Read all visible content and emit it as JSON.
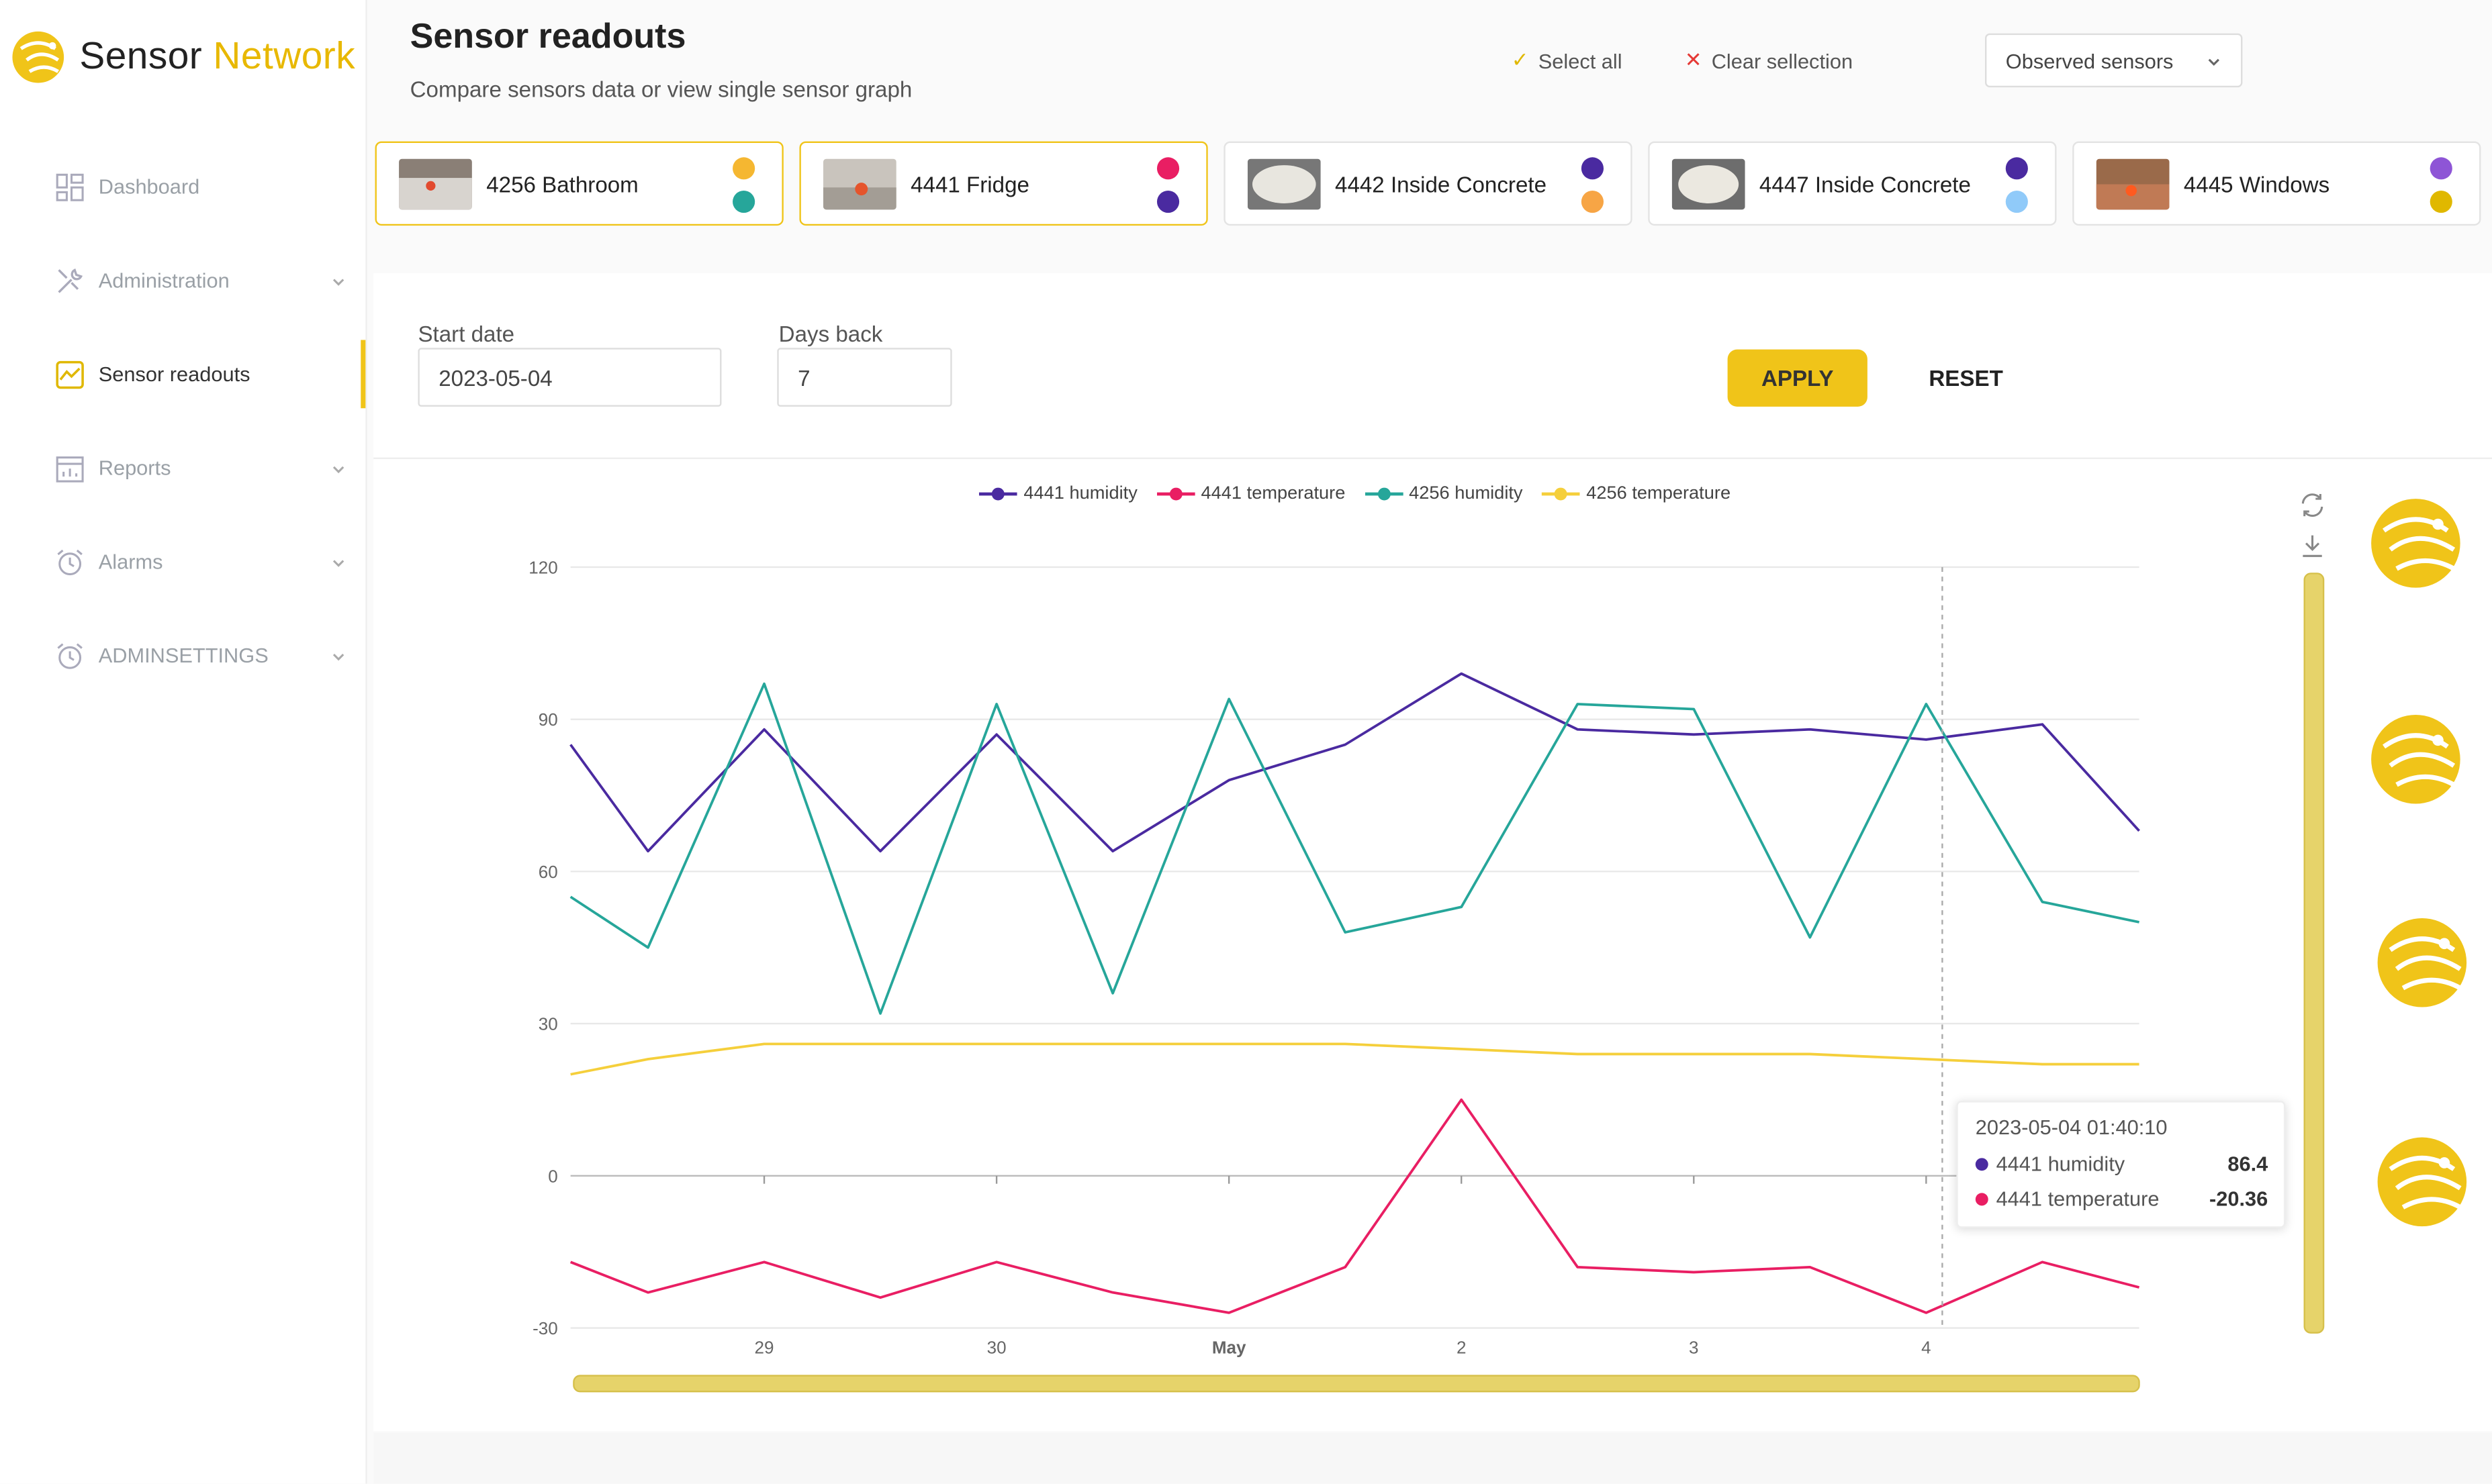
{
  "brand": {
    "name_part1": "Sensor",
    "name_part2": "Network",
    "color": "#f0c419"
  },
  "sidebar": {
    "items": [
      {
        "label": "Dashboard",
        "icon": "dashboard-icon",
        "active": false,
        "expandable": false
      },
      {
        "label": "Administration",
        "icon": "tools-icon",
        "active": false,
        "expandable": true
      },
      {
        "label": "Sensor readouts",
        "icon": "chart-window-icon",
        "active": true,
        "expandable": false
      },
      {
        "label": "Reports",
        "icon": "report-icon",
        "active": false,
        "expandable": true
      },
      {
        "label": "Alarms",
        "icon": "alarm-clock-icon",
        "active": false,
        "expandable": true
      },
      {
        "label": "ADMINSETTINGS",
        "icon": "alarm-clock-icon",
        "active": false,
        "expandable": true
      }
    ]
  },
  "header": {
    "title": "Sensor readouts",
    "subtitle": "Compare sensors data or view single sensor graph",
    "select_all": "Select all",
    "clear_selection": "Clear sellection",
    "dropdown_value": "Observed sensors"
  },
  "sensors": [
    {
      "label": "4256 Bathroom",
      "selected": true,
      "dot1": "#f5b731",
      "dot2": "#26a69a"
    },
    {
      "label": "4441 Fridge",
      "selected": true,
      "dot1": "#e91e63",
      "dot2": "#4a2aa0"
    },
    {
      "label": "4442 Inside Concrete",
      "selected": false,
      "dot1": "#4a2aa0",
      "dot2": "#f7a545"
    },
    {
      "label": "4447 Inside Concrete",
      "selected": false,
      "dot1": "#4a2aa0",
      "dot2": "#90caf9"
    },
    {
      "label": "4445 Windows",
      "selected": false,
      "dot1": "#8e55d6",
      "dot2": "#e0b800"
    }
  ],
  "filters": {
    "start_date_label": "Start date",
    "start_date_value": "2023-05-04",
    "days_back_label": "Days back",
    "days_back_value": "7",
    "apply_label": "APPLY",
    "reset_label": "RESET"
  },
  "tooltip": {
    "title": "2023-05-04 01:40:10",
    "rows": [
      {
        "label": "4441 humidity",
        "value": "86.4",
        "color": "#4a2aa0"
      },
      {
        "label": "4441 temperature",
        "value": "-20.36",
        "color": "#e91e63"
      }
    ]
  },
  "chart_data": {
    "type": "line",
    "title": "",
    "xlabel": "",
    "ylabel": "",
    "ylim": [
      -30,
      120
    ],
    "yticks": [
      120,
      90,
      60,
      30,
      0,
      -30
    ],
    "x_tick_labels": [
      "29",
      "30",
      "May",
      "2",
      "3",
      "4"
    ],
    "x": [
      "2023-04-28 04:00",
      "2023-04-28 12:00",
      "2023-04-29 00:00",
      "2023-04-29 12:00",
      "2023-04-30 00:00",
      "2023-04-30 12:00",
      "2023-05-01 00:00",
      "2023-05-01 12:00",
      "2023-05-02 00:00",
      "2023-05-02 12:00",
      "2023-05-03 00:00",
      "2023-05-03 12:00",
      "2023-05-04 00:00",
      "2023-05-04 12:00",
      "2023-05-04 22:00"
    ],
    "legend_position": "top",
    "grid": true,
    "series": [
      {
        "name": "4441 humidity",
        "color": "#4a2aa0",
        "values": [
          85,
          64,
          88,
          64,
          87,
          64,
          78,
          85,
          99,
          88,
          87,
          88,
          86,
          89,
          68
        ]
      },
      {
        "name": "4441 temperature",
        "color": "#e91e63",
        "values": [
          -17,
          -23,
          -17,
          -24,
          -17,
          -23,
          -27,
          -18,
          15,
          -18,
          -19,
          -18,
          -27,
          -17,
          -22
        ]
      },
      {
        "name": "4256 humidity",
        "color": "#26a69a",
        "values": [
          55,
          45,
          97,
          32,
          93,
          36,
          94,
          48,
          53,
          93,
          92,
          47,
          93,
          54,
          50
        ]
      },
      {
        "name": "4256 temperature",
        "color": "#f5cf3b",
        "values": [
          20,
          23,
          26,
          26,
          26,
          26,
          26,
          26,
          25,
          24,
          24,
          24,
          23,
          22,
          22
        ]
      }
    ]
  }
}
